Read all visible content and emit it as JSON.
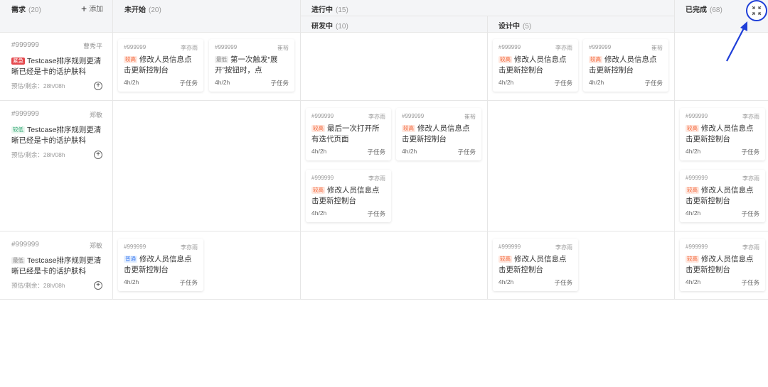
{
  "columns": {
    "demand": {
      "label": "需求",
      "count": "(20)",
      "add_label": "添加"
    },
    "todo": {
      "label": "未开始",
      "count": "(20)"
    },
    "inprogress": {
      "label": "进行中",
      "count": "(15)"
    },
    "dev": {
      "label": "研发中",
      "count": "(10)"
    },
    "design": {
      "label": "设计中",
      "count": "(5)"
    },
    "done": {
      "label": "已完成",
      "count": "(68)"
    }
  },
  "stories": [
    {
      "id": "#999999",
      "owner": "曹秀平",
      "tag": "紧急",
      "title": "Testcase排序规则更清晰已经是卡的话护肤科",
      "est": "预估/剩余：28h/08h"
    },
    {
      "id": "#999999",
      "owner": "郑敏",
      "tag": "较低",
      "title": "Testcase排序规则更清晰已经是卡的话护肤科",
      "est": "预估/剩余：28h/08h"
    },
    {
      "id": "#999999",
      "owner": "郑敏",
      "tag": "最低",
      "title": "Testcase排序规则更清晰已经是卡的话护肤科",
      "est": "预估/剩余：28h/08h"
    }
  ],
  "cards": {
    "r1_todo_1": {
      "id": "#999999",
      "owner": "李亦雨",
      "tag": "较高",
      "title": "修改人员信息点击更新控制台",
      "time": "4h/2h",
      "sub": "子任务"
    },
    "r1_todo_2": {
      "id": "#999999",
      "owner": "崔裕",
      "tag": "最低",
      "title": "第一次触发“展开”按钮时，点",
      "time": "4h/2h",
      "sub": "子任务"
    },
    "r1_design_1": {
      "id": "#999999",
      "owner": "李亦雨",
      "tag": "较高",
      "title": "修改人员信息点击更新控制台",
      "time": "4h/2h",
      "sub": "子任务"
    },
    "r1_design_2": {
      "id": "#999999",
      "owner": "崔裕",
      "tag": "较高",
      "title": "修改人员信息点击更新控制台",
      "time": "4h/2h",
      "sub": "子任务"
    },
    "r2_dev_1": {
      "id": "#999999",
      "owner": "李亦雨",
      "tag": "较高",
      "title": "最后一次打开所有迭代页面",
      "time": "4h/2h",
      "sub": "子任务"
    },
    "r2_dev_2": {
      "id": "#999999",
      "owner": "崔裕",
      "tag": "较高",
      "title": "修改人员信息点击更新控制台",
      "time": "4h/2h",
      "sub": "子任务"
    },
    "r2_dev_3": {
      "id": "#999999",
      "owner": "李亦雨",
      "tag": "较高",
      "title": "修改人员信息点击更新控制台",
      "time": "4h/2h",
      "sub": "子任务"
    },
    "r2_done_1": {
      "id": "#999999",
      "owner": "李亦雨",
      "tag": "较高",
      "title": "修改人员信息点击更新控制台",
      "time": "4h/2h",
      "sub": "子任务"
    },
    "r2_done_2": {
      "id": "#999999",
      "owner": "李亦雨",
      "tag": "较高",
      "title": "修改人员信息点击更新控制台",
      "time": "4h/2h",
      "sub": "子任务"
    },
    "r3_todo_1": {
      "id": "#999999",
      "owner": "李亦雨",
      "tag": "普通",
      "title": "修改人员信息点击更新控制台",
      "time": "4h/2h",
      "sub": "子任务"
    },
    "r3_design_1": {
      "id": "#999999",
      "owner": "李亦雨",
      "tag": "较高",
      "title": "修改人员信息点击更新控制台",
      "time": "4h/2h",
      "sub": "子任务"
    },
    "r3_done_1": {
      "id": "#999999",
      "owner": "李亦雨",
      "tag": "较高",
      "title": "修改人员信息点击更新控制台",
      "time": "4h/2h",
      "sub": "子任务"
    }
  },
  "colors": {
    "accent": "#1f3fd8",
    "high": "#f25c2c",
    "urgent": "#e5484d",
    "low": "#2ba471",
    "normal": "#3b7bf0"
  },
  "icons": {
    "collapse": "collapse-icon",
    "plus": "plus-icon",
    "add_circle": "plus-circle-icon"
  }
}
